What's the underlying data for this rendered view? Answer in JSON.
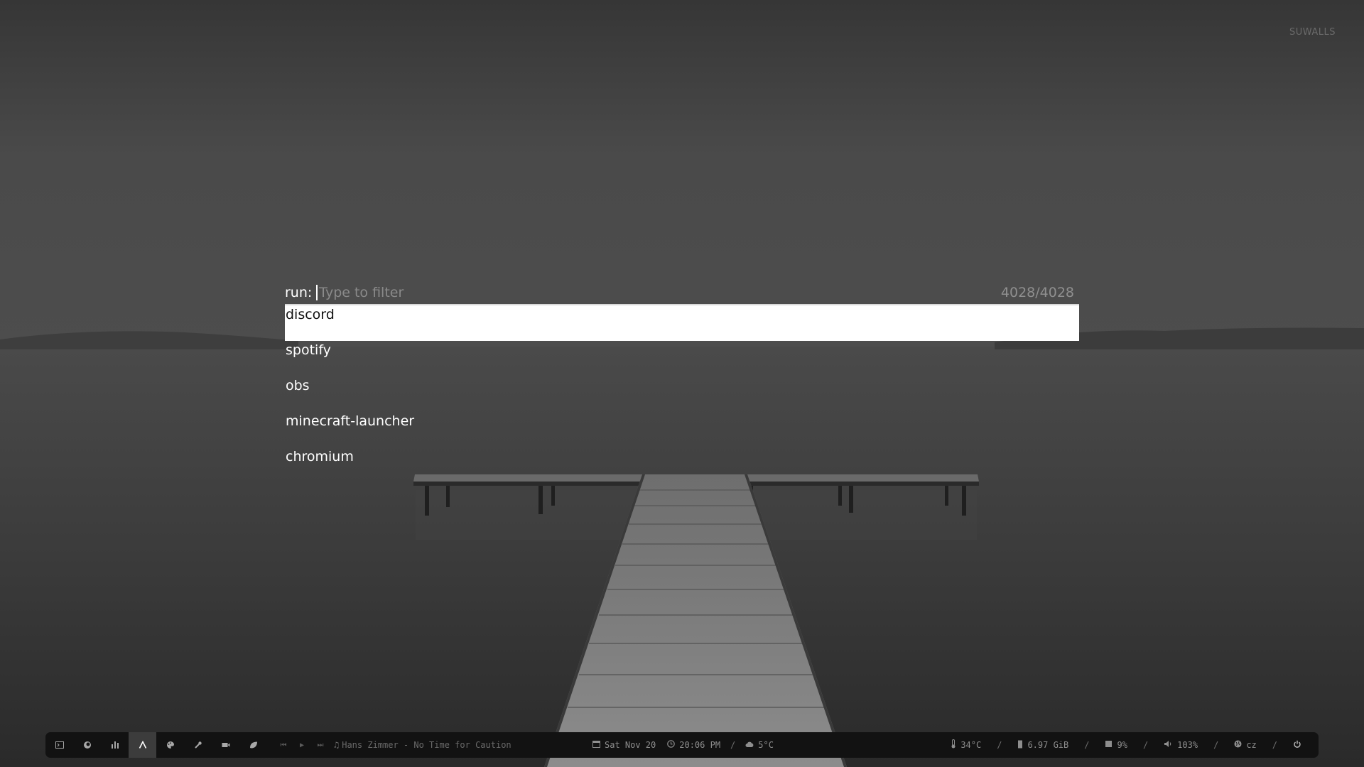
{
  "wallpaper": {
    "watermark": "SUWALLS"
  },
  "launcher": {
    "prompt": "run:",
    "filter_placeholder": "Type to filter",
    "filter_value": "",
    "match_count": "4028/4028",
    "results": [
      "discord",
      "spotify",
      "obs",
      "minecraft-launcher",
      "chromium"
    ],
    "selected_index": 0
  },
  "taskbar": {
    "apps": [
      {
        "icon": "terminal-icon"
      },
      {
        "icon": "firefox-icon"
      },
      {
        "icon": "monitor-bars-icon"
      },
      {
        "icon": "launcher-icon",
        "active": true
      },
      {
        "icon": "palette-icon"
      },
      {
        "icon": "wrench-icon"
      },
      {
        "icon": "video-camera-icon"
      },
      {
        "icon": "leaf-icon"
      }
    ],
    "media": {
      "prev_icon": "skip-previous-icon",
      "play_icon": "play-icon",
      "next_icon": "skip-next-icon",
      "now_playing": "Hans Zimmer - No Time for Caution"
    },
    "date": "Sat Nov 20",
    "time": "20:06 PM",
    "weather": "5°C",
    "separator": "/",
    "cpu_temp": "34°C",
    "memory": "6.97 GiB",
    "cpu_usage": "9%",
    "volume": "103%",
    "keyboard_layout": "cz"
  },
  "colors": {
    "taskbar_bg": "#121212",
    "active_app_bg": "#3c3c3c",
    "selected_row_bg": "#ffffff"
  }
}
